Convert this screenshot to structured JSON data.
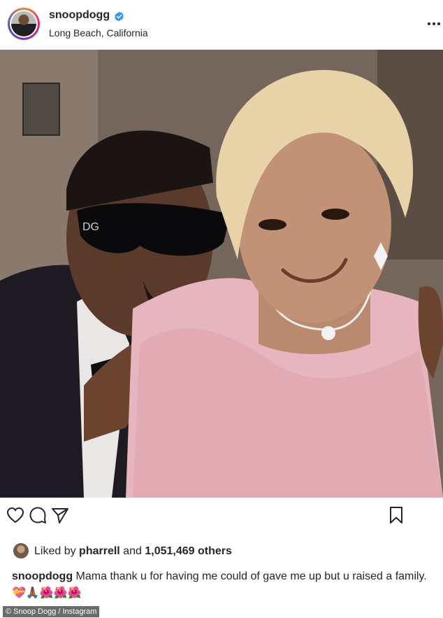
{
  "header": {
    "username": "snoopdogg",
    "location": "Long Beach, California",
    "verified_color": "#3897f0"
  },
  "photo": {
    "kind": "post-photo"
  },
  "actions": {
    "icons": [
      "heart-icon",
      "comment-icon",
      "share-icon",
      "bookmark-icon"
    ]
  },
  "likes": {
    "prefix": "Liked by",
    "user": "pharrell",
    "and": "and",
    "count": "1,051,469 others"
  },
  "caption": {
    "username": "snoopdogg",
    "text": "Mama thank u for having me could of gave me up but u raised a family.",
    "emojis": "💝🙏🏾🌺🌺🌺"
  },
  "credit": "© Snoop Dogg / Instagram",
  "colors": {
    "text": "#262626",
    "verified": "#3897f0",
    "credit_bg": "#6b6b6b"
  }
}
